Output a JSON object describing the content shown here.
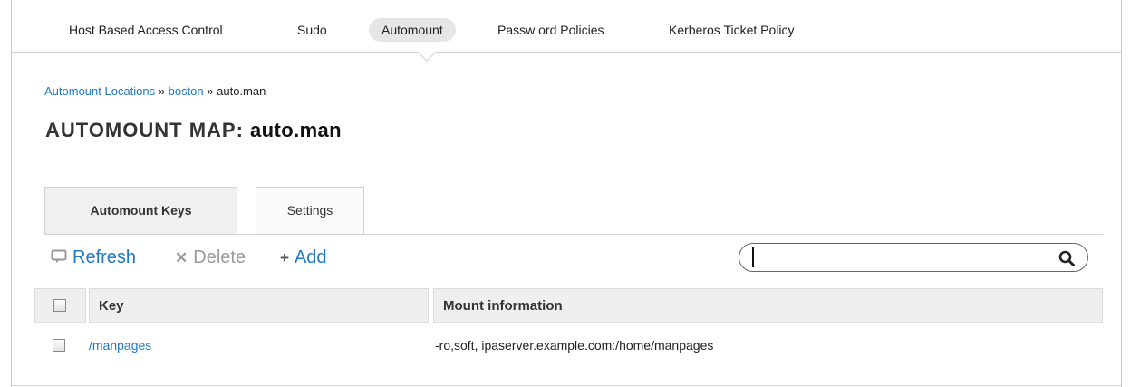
{
  "nav": {
    "items": [
      {
        "label": "Host Based Access Control",
        "active": false
      },
      {
        "label": "Sudo",
        "active": false
      },
      {
        "label": "Automount",
        "active": true
      },
      {
        "label": "Passw ord Policies",
        "active": false
      },
      {
        "label": "Kerberos Ticket Policy",
        "active": false
      }
    ]
  },
  "breadcrumb": {
    "locations": "Automount Locations",
    "sep1": " » ",
    "location": "boston",
    "sep2": " » ",
    "current": "auto.man"
  },
  "title": {
    "prefix": "AUTOMOUNT MAP: ",
    "object": "auto.man"
  },
  "tabs": [
    {
      "label": "Automount Keys",
      "active": true
    },
    {
      "label": "Settings",
      "active": false
    }
  ],
  "actions": {
    "refresh": "Refresh",
    "delete": "Delete",
    "add": "Add"
  },
  "search": {
    "value": "",
    "icon": "search-icon"
  },
  "table": {
    "columns": [
      "Key",
      "Mount information"
    ],
    "rows": [
      {
        "key": "/manpages",
        "mount": "-ro,soft, ipaserver.example.com:/home/manpages"
      }
    ]
  },
  "colors": {
    "link": "#1d79c6",
    "header_bg": "#efefef",
    "active_nav_bg": "#e6e6e6"
  }
}
